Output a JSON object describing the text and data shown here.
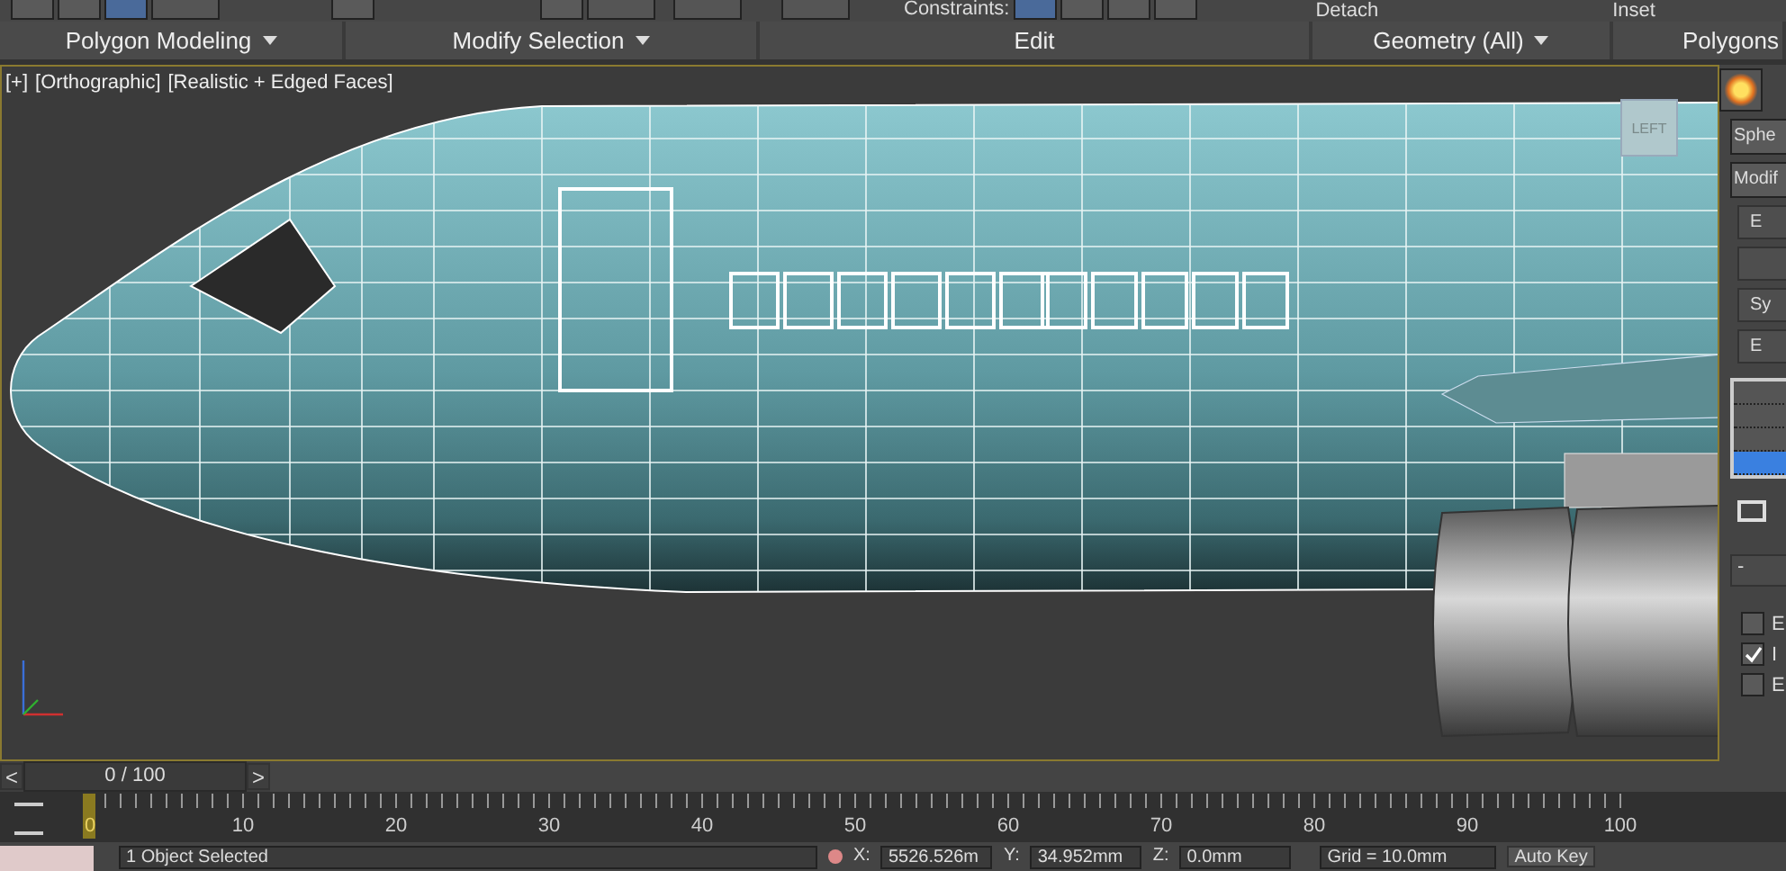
{
  "toolbar_top": {
    "constraints_label": "Constraints:",
    "detach_label": "Detach",
    "inset_label": "Inset"
  },
  "ribbon_panels": [
    {
      "label": "Polygon Modeling",
      "dropdown": true
    },
    {
      "label": "Modify Selection",
      "dropdown": true
    },
    {
      "label": "Edit",
      "dropdown": false
    },
    {
      "label": "Geometry (All)",
      "dropdown": true
    },
    {
      "label": "Polygons",
      "dropdown": false
    }
  ],
  "viewport": {
    "labels": [
      "[+]",
      "[Orthographic]",
      "[Realistic + Edged Faces]"
    ],
    "viewcube": "LEFT"
  },
  "command_panel": {
    "object_name": "Sphe",
    "modifier_list": "Modif",
    "buttons": [
      "E",
      "Sy",
      "E"
    ],
    "stack_rows": [
      {
        "selected": false
      },
      {
        "selected": false
      },
      {
        "selected": false
      },
      {
        "selected": true
      }
    ],
    "rollout_toggle": "-",
    "checkboxes": [
      {
        "label": "E",
        "checked": false
      },
      {
        "label": "I",
        "checked": true
      },
      {
        "label": "E",
        "checked": false
      }
    ]
  },
  "timeline": {
    "level": 0,
    "prev": "<",
    "frame_counter": "0 / 100",
    "next": ">",
    "ticks": [
      "0",
      "10",
      "20",
      "30",
      "40",
      "50",
      "60",
      "70",
      "80",
      "90",
      "100"
    ]
  },
  "status_bar": {
    "selection": "1 Object Selected",
    "x_label": "X:",
    "x_value": "5526.526m",
    "y_label": "Y:",
    "y_value": "34.952mm",
    "z_label": "Z:",
    "z_value": "0.0mm",
    "grid": "Grid = 10.0mm",
    "auto_key": "Auto Key"
  }
}
